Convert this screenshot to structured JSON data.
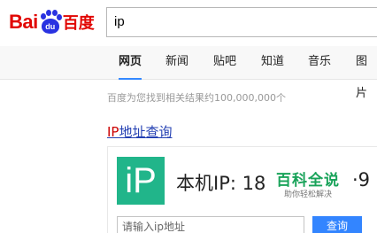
{
  "logo": {
    "left_text": "Bai",
    "paw_text": "du",
    "right_text": "百度",
    "brand_red": "#e10602",
    "brand_blue": "#2932e1"
  },
  "search": {
    "query": "ip"
  },
  "tabs": [
    {
      "label": "网页",
      "active": true
    },
    {
      "label": "新闻",
      "active": false
    },
    {
      "label": "贴吧",
      "active": false
    },
    {
      "label": "知道",
      "active": false
    },
    {
      "label": "音乐",
      "active": false
    },
    {
      "label": "图片",
      "active": false
    }
  ],
  "results": {
    "count_text": "百度为您找到相关结果约100,000,000个",
    "first": {
      "title_highlight": "IP",
      "title_rest": "地址查询",
      "card": {
        "logo_text": "iP",
        "ip_text": "本机IP: 18",
        "ip_tail": "·9",
        "input_placeholder": "请输入ip地址",
        "query_button": "查询"
      }
    }
  },
  "watermark": {
    "title": "百科全说",
    "subtitle": "助你轻松解决"
  },
  "colors": {
    "tab_underline": "#3388ff",
    "link": "#2440b3",
    "highlight": "#cc0000",
    "ip_logo_bg": "#21b58a",
    "button": "#3385ff"
  }
}
